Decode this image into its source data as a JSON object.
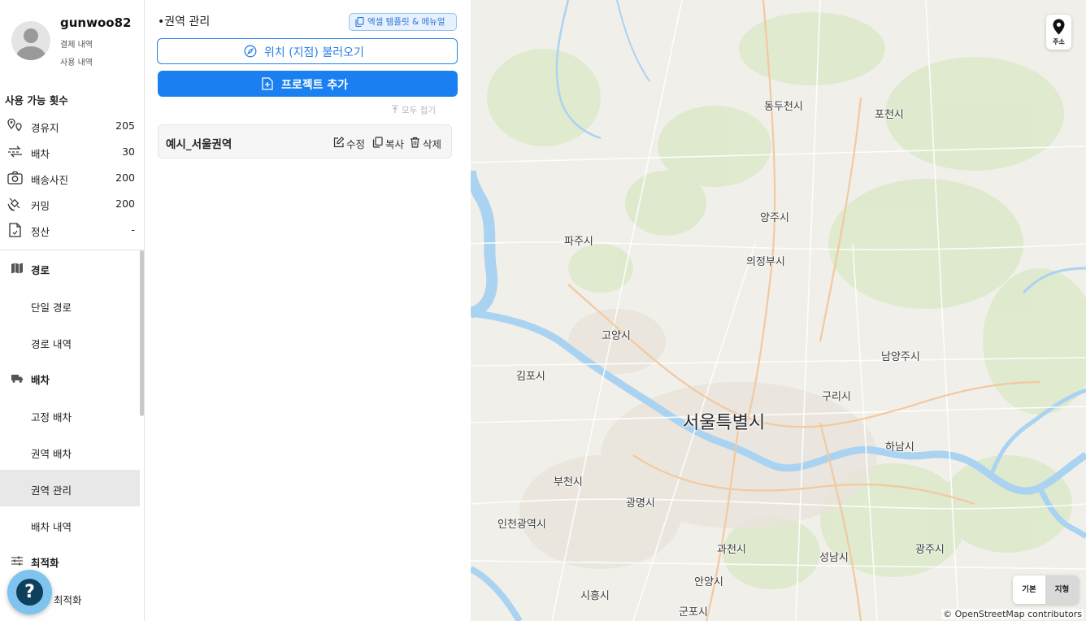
{
  "profile": {
    "username": "gunwoo82",
    "links": [
      "결제 내역",
      "사용 내역"
    ]
  },
  "usage": {
    "title": "사용 가능 횟수",
    "items": [
      {
        "label": "경유지",
        "value": "205",
        "icon": "waypoint-icon"
      },
      {
        "label": "배차",
        "value": "30",
        "icon": "dispatch-icon"
      },
      {
        "label": "배송사진",
        "value": "200",
        "icon": "camera-icon"
      },
      {
        "label": "커밍",
        "value": "200",
        "icon": "satellite-icon"
      },
      {
        "label": "정산",
        "value": "-",
        "icon": "settlement-icon"
      }
    ]
  },
  "nav": {
    "route": {
      "label": "경로",
      "items": [
        "단일 경로",
        "경로 내역"
      ]
    },
    "dispatch": {
      "label": "배차",
      "items": [
        "고정 배차",
        "권역 배차",
        "권역 관리",
        "배차 내역"
      ]
    },
    "optimize": {
      "label": "최적화",
      "items": [
        "최적화"
      ]
    },
    "active_item": "권역 관리"
  },
  "help": {
    "label": "?"
  },
  "panel": {
    "title": "•권역 관리",
    "excel_button": "엑셀 템플릿 & 메뉴얼",
    "load_location_button": "위치 (지점) 불러오기",
    "add_project_button": "프로젝트 추가",
    "collapse_all": "모두 접기",
    "presets": [
      {
        "name": "예시_서울권역",
        "actions": {
          "edit": "수정",
          "copy": "복사",
          "delete": "삭제"
        }
      }
    ]
  },
  "map": {
    "address_button": "주소",
    "map_types": {
      "basic": "기본",
      "terrain": "지형"
    },
    "selected_map_type": "지형",
    "attribution": "© OpenStreetMap contributors",
    "cities": {
      "dongducheon": "동두천시",
      "pocheon": "포천시",
      "yangju": "양주시",
      "paju": "파주시",
      "uijeongbu": "의정부시",
      "goyang": "고양시",
      "namyangju": "남양주시",
      "gimpo": "김포시",
      "guri": "구리시",
      "seoul": "서울특별시",
      "hanam": "하남시",
      "bucheon": "부천시",
      "gwangmyeong": "광명시",
      "incheon": "인천광역시",
      "gwacheon": "과천시",
      "gwangju": "광주시",
      "seongnam": "성남시",
      "anyang": "안양시",
      "siheung": "시흥시",
      "gunpo": "군포시"
    },
    "colors": {
      "land": "#f1efe9",
      "water": "#aad3f2",
      "forest": "#d8e8c4",
      "road_major": "#f2c9a0",
      "road_minor": "#ffffff"
    }
  }
}
